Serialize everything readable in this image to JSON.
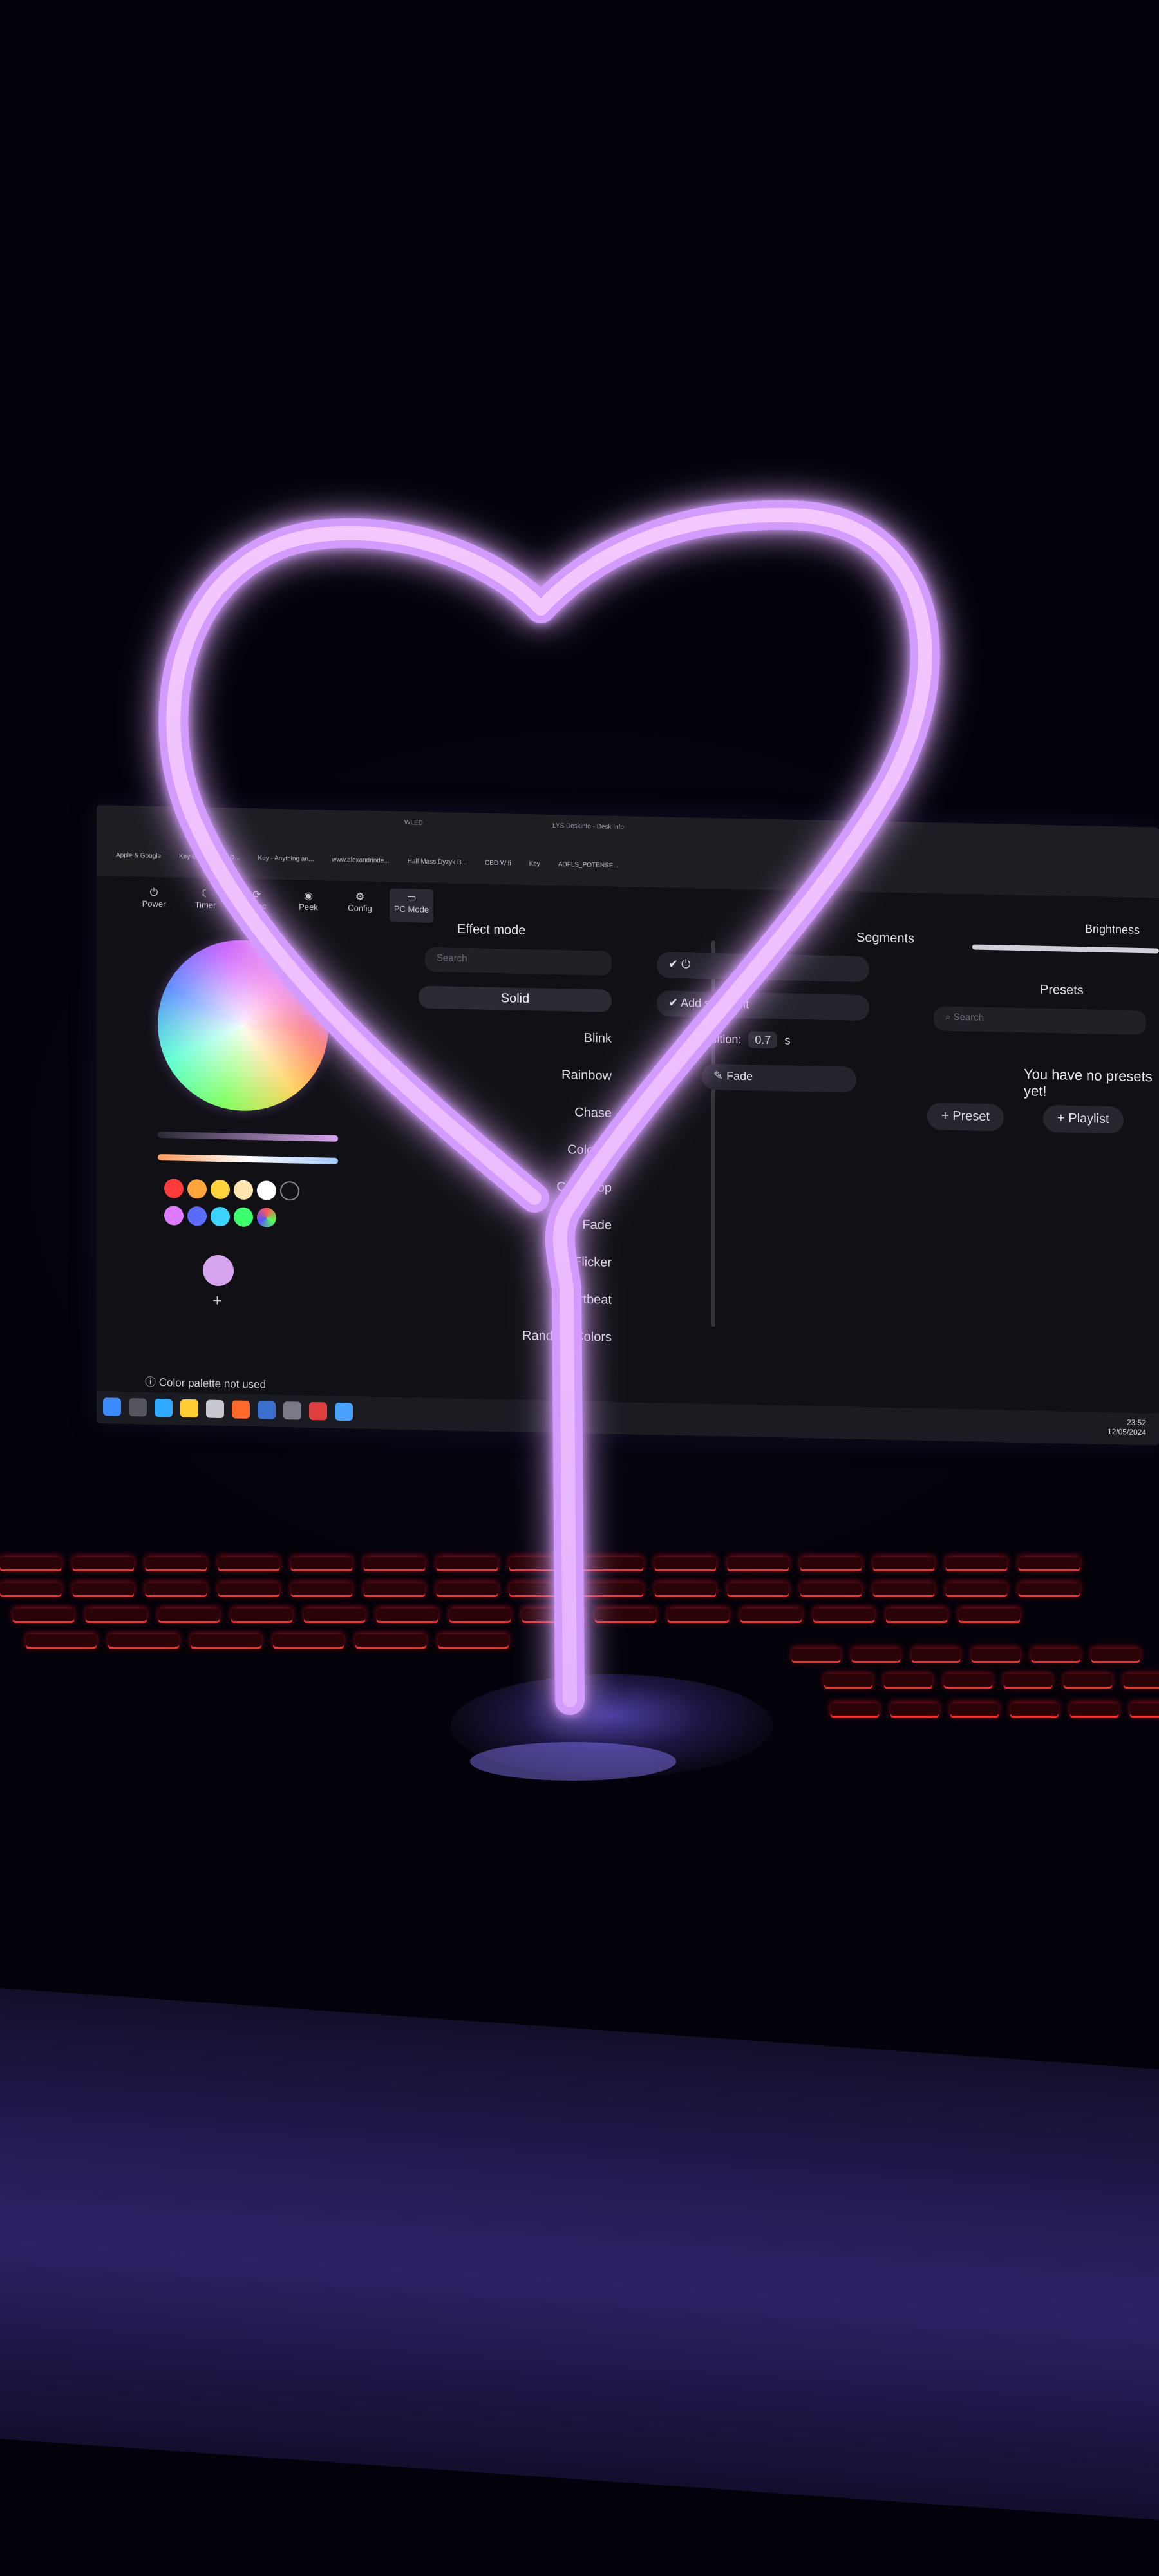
{
  "browser": {
    "tabs": [
      "WLED",
      "LYS Deskinfo - Desk Info"
    ],
    "bookmarks": [
      "Apple & Google",
      "Key GPU, Steam D...",
      "Key - Anything an...",
      "www.alexandrinde...",
      "Half Mass Dyzyk B...",
      "CBD Wifi",
      "Key",
      "ADFLS_POTENSE..."
    ]
  },
  "app": {
    "nav": [
      {
        "label": "Power",
        "icon": "power-icon"
      },
      {
        "label": "Timer",
        "icon": "moon-icon"
      },
      {
        "label": "Sync",
        "icon": "sync-icon"
      },
      {
        "label": "Peek",
        "icon": "eye-icon"
      },
      {
        "label": "Config",
        "icon": "gear-icon"
      },
      {
        "label": "PC Mode",
        "icon": "monitor-icon"
      }
    ],
    "color_palette_note": "Color palette not used",
    "effect_mode": {
      "title": "Effect mode",
      "search_placeholder": "Search",
      "effects": [
        "Solid",
        "Blink",
        "Rainbow",
        "Chase",
        "Colorful",
        "Colorloop",
        "Fade",
        "Fire Flicker",
        "Heartbeat",
        "Random Colors"
      ],
      "selected": "Solid"
    },
    "segments": {
      "title": "Segments",
      "transition_label": "Transition:",
      "transition_value": "0.7",
      "transition_unit": "s",
      "fade_label": "Fade",
      "add_segment_label": "Add segment"
    },
    "brightness_label": "Brightness",
    "presets": {
      "title": "Presets",
      "search_placeholder": "Search",
      "empty_text": "You have no presets yet!",
      "add_preset_label": "+ Preset",
      "add_playlist_label": "+ Playlist"
    },
    "taskbar": {
      "time": "23:52",
      "date": "12/05/2024"
    }
  },
  "colors": {
    "heart_glow": "#d8a0ff",
    "heart_core": "#ffd8ff",
    "keyboard_backlight": "#ff2a2a",
    "desk": "#2b2266"
  }
}
